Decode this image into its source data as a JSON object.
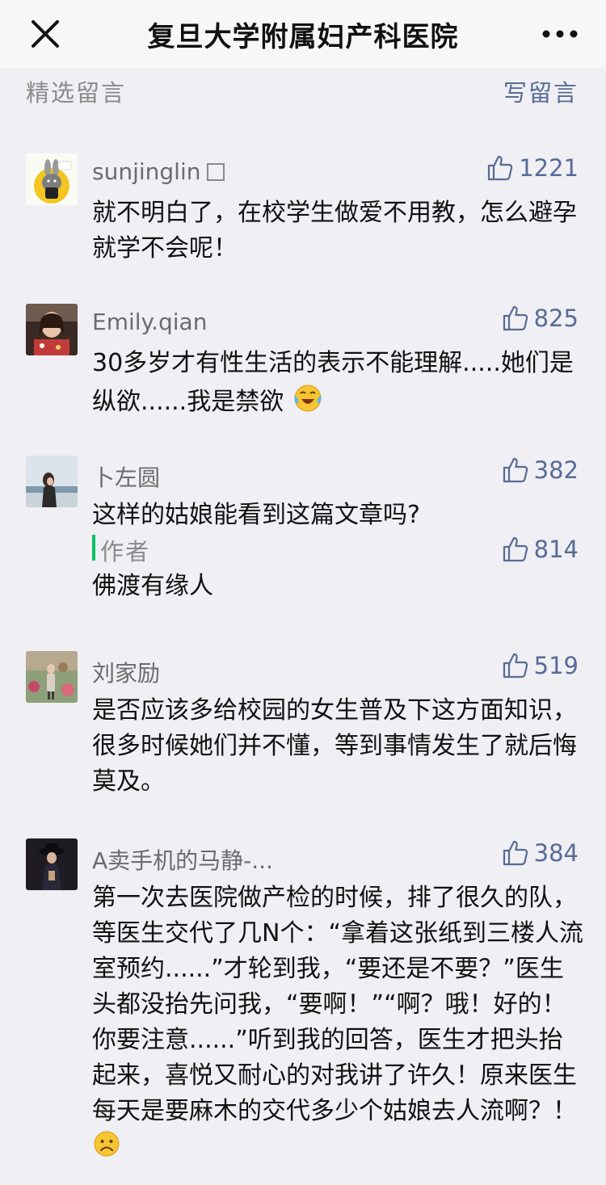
{
  "header": {
    "title": "复旦大学附属妇产科医院"
  },
  "section": {
    "label": "精选留言",
    "write_label": "写留言"
  },
  "comments": [
    {
      "nickname": "sunjinglin",
      "likes": "1221",
      "text": "就不明白了，在校学生做爱不用教，怎么避孕就学不会呢！",
      "avatar_icon": "cartoon-bunny-avatar"
    },
    {
      "nickname": "Emily.qian",
      "likes": "825",
      "text": "30多岁才有性生活的表示不能理解.....她们是纵欲......我是禁欲",
      "emoji": "crying-laughing-emoji",
      "avatar_icon": "woman-photo-avatar"
    },
    {
      "nickname": "卜左圆",
      "likes": "382",
      "text": "这样的姑娘能看到这篇文章吗?",
      "avatar_icon": "seaside-photo-avatar",
      "reply": {
        "label": "作者",
        "likes": "814",
        "text": "佛渡有缘人"
      }
    },
    {
      "nickname": "刘家励",
      "likes": "519",
      "text": "是否应该多给校园的女生普及下这方面知识，很多时候她们并不懂，等到事情发生了就后悔莫及。",
      "avatar_icon": "garden-photo-avatar"
    },
    {
      "nickname": "A卖手机的马静-...",
      "likes": "384",
      "text": "第一次去医院做产检的时候，排了很久的队，等医生交代了几N个：“拿着这张纸到三楼人流室预约......”才轮到我，“要还是不要？”医生头都没抬先问我，“要啊！”“啊？哦！好的！你要注意......”听到我的回答，医生才把头抬起来，喜悦又耐心的对我讲了许久！原来医生每天是要麻木的交代多少个姑娘去人流啊？！",
      "emoji": "sad-face-emoji",
      "avatar_icon": "hat-woman-avatar"
    }
  ],
  "colors": {
    "link": "#576b95",
    "accent": "#07c160",
    "background": "#efeff4"
  }
}
